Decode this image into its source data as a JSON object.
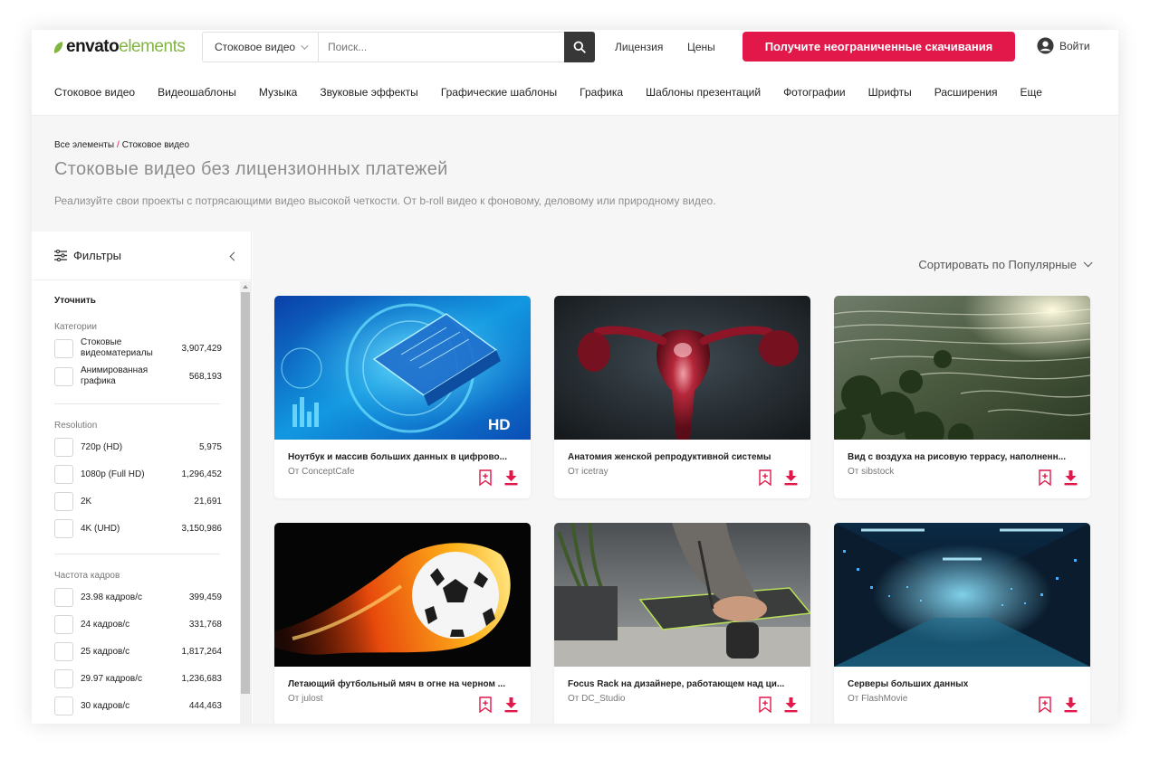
{
  "header": {
    "logo_bold": "envato",
    "logo_light": "elements",
    "search_category": "Стоковое видео",
    "search_placeholder": "Поиск...",
    "license_link": "Лицензия",
    "prices_link": "Цены",
    "cta_label": "Получите неограниченные скачивания",
    "login_label": "Войти",
    "accent_color": "#e2174a"
  },
  "nav": {
    "items": [
      "Стоковое видео",
      "Видеошаблоны",
      "Музыка",
      "Звуковые эффекты",
      "Графические шаблоны",
      "Графика",
      "Шаблоны презентаций",
      "Фотографии",
      "Шрифты",
      "Расширения",
      "Еще"
    ]
  },
  "page": {
    "breadcrumb_root": "Все элементы",
    "breadcrumb_sep": "/",
    "breadcrumb_current": "Стоковое видео",
    "title": "Стоковые видео без лицензионных платежей",
    "description": "Реализуйте свои проекты с потрясающими видео высокой четкости. От b-roll видео к фоновому, деловому или природному видео."
  },
  "filters": {
    "title": "Фильтры",
    "refine_label": "Уточнить",
    "categories_label": "Категории",
    "categories": [
      {
        "label": "Стоковые видеоматериалы",
        "count": "3,907,429"
      },
      {
        "label": "Анимированная графика",
        "count": "568,193"
      }
    ],
    "resolution_label": "Resolution",
    "resolution": [
      {
        "label": "720p (HD)",
        "count": "5,975"
      },
      {
        "label": "1080p (Full HD)",
        "count": "1,296,452"
      },
      {
        "label": "2K",
        "count": "21,691"
      },
      {
        "label": "4K (UHD)",
        "count": "3,150,986"
      }
    ],
    "framerate_label": "Частота кадров",
    "framerate": [
      {
        "label": "23.98 кадров/с",
        "count": "399,459"
      },
      {
        "label": "24 кадров/с",
        "count": "331,768"
      },
      {
        "label": "25 кадров/с",
        "count": "1,817,264"
      },
      {
        "label": "29.97 кадров/с",
        "count": "1,236,683"
      },
      {
        "label": "30 кадров/с",
        "count": "444,463"
      }
    ]
  },
  "sort": {
    "label": "Сортировать по Популярные"
  },
  "cards": [
    {
      "title": "Ноутбук и массив больших данных в цифрово...",
      "author": "От ConceptCafe",
      "badge": "HD"
    },
    {
      "title": "Анатомия женской репродуктивной системы",
      "author": "От icetray"
    },
    {
      "title": "Вид с воздуха на рисовую террасу, наполненн...",
      "author": "От sibstock"
    },
    {
      "title": "Летающий футбольный мяч в огне на черном ...",
      "author": "От julost"
    },
    {
      "title": "Focus Rack на дизайнере, работающем над ци...",
      "author": "От DC_Studio"
    },
    {
      "title": "Серверы больших данных",
      "author": "От FlashMovie"
    }
  ]
}
